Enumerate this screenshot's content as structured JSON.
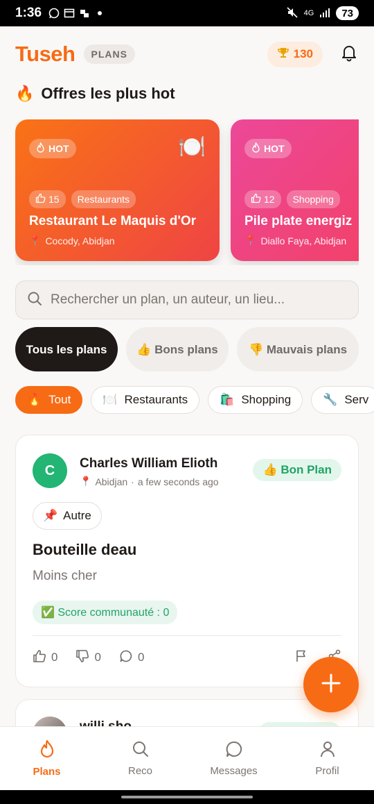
{
  "status_bar": {
    "time": "1:36",
    "network": "4G",
    "battery": "73"
  },
  "header": {
    "logo": "Tuseh",
    "section_badge": "PLANS",
    "score": "130",
    "score_icon": "trophy-icon",
    "notifications_icon": "bell-icon"
  },
  "hot_section": {
    "title": "Offres les plus hot",
    "icon": "fire-icon",
    "cards": [
      {
        "tag": "HOT",
        "likes": "15",
        "category": "Restaurants",
        "title": "Restaurant Le Maquis d'Or",
        "location": "Cocody, Abidjan",
        "emoji": "🍽️"
      },
      {
        "tag": "HOT",
        "likes": "12",
        "category": "Shopping",
        "title": "Pile plate energiz",
        "location": "Diallo Faya, Abidjan",
        "emoji": ""
      }
    ]
  },
  "search": {
    "placeholder": "Rechercher un plan, un auteur, un lieu..."
  },
  "segments": [
    {
      "label": "Tous les plans",
      "active": true
    },
    {
      "label": "👍 Bons plans",
      "active": false
    },
    {
      "label": "👎 Mauvais plans",
      "active": false
    }
  ],
  "categories": [
    {
      "emoji": "🔥",
      "label": "Tout",
      "active": true
    },
    {
      "emoji": "🍽️",
      "label": "Restaurants",
      "active": false
    },
    {
      "emoji": "🛍️",
      "label": "Shopping",
      "active": false
    },
    {
      "emoji": "🔧",
      "label": "Serv",
      "active": false
    }
  ],
  "post": {
    "avatar_letter": "C",
    "author": "Charles William Elioth",
    "location": "Abidjan",
    "time": "a few seconds ago",
    "badge": "👍 Bon Plan",
    "category": "Autre",
    "category_emoji": "📌",
    "title": "Bouteille deau",
    "description": "Moins cher",
    "score": "✅ Score communauté : 0",
    "likes": "0",
    "dislikes": "0",
    "comments": "0"
  },
  "post2": {
    "author": "willi sho"
  },
  "bottom_nav": [
    {
      "label": "Plans",
      "icon": "flame-icon",
      "active": true
    },
    {
      "label": "Reco",
      "icon": "search-icon",
      "active": false
    },
    {
      "label": "Messages",
      "icon": "message-icon",
      "active": false
    },
    {
      "label": "Profil",
      "icon": "user-icon",
      "active": false
    }
  ],
  "colors": {
    "brand": "#f76b15",
    "success": "#22a366",
    "dark": "#1f1a17"
  }
}
